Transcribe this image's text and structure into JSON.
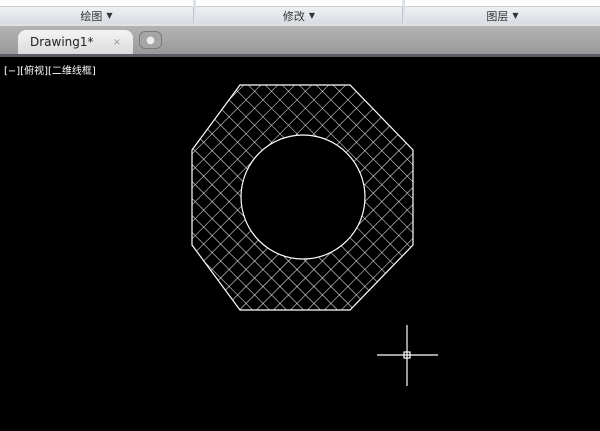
{
  "ribbon": {
    "panels": [
      {
        "label": "绘图"
      },
      {
        "label": "修改"
      },
      {
        "label": "图层"
      }
    ]
  },
  "tabs": [
    {
      "label": "Drawing1*",
      "close": "×"
    }
  ],
  "new_tab_icon": "plus-icon",
  "viewport": {
    "label": "[−][俯视][二维线框]"
  },
  "colors": {
    "background": "#000000",
    "geometry": "#ffffff"
  }
}
